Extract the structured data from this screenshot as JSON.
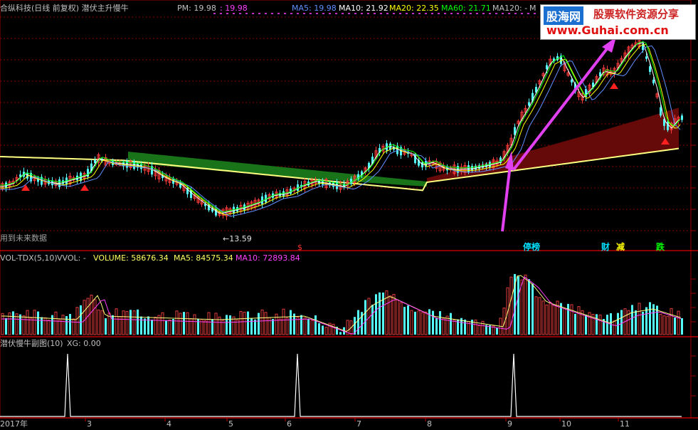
{
  "main_panel": {
    "title": "合纵科技(日线 前复权) 潜伏主升慢牛",
    "pm_label": "PM: 19.98",
    "pm_value": ": 19.98",
    "ma5": "MA5: 19.98",
    "ma10": "MA10: 21.92",
    "ma20": "MA20: 22.35",
    "ma60": "MA60: 21.71",
    "ma120": "MA120: -",
    "ma_extra": "M",
    "future_note": "用到未来数据",
    "low_price_label": "←13.59",
    "dollar_mark": "$",
    "tags": [
      {
        "text": "停榜",
        "color": "#00e0ff"
      },
      {
        "text": "财",
        "color": "#00e0ff"
      },
      {
        "text": "减",
        "color": "#ffff00"
      },
      {
        "text": "跌",
        "color": "#00ff00"
      }
    ]
  },
  "volume_panel": {
    "indicator": "VOL-TDX(5,10)",
    "vol": "VVOL: -",
    "volume": "VOLUME: 58676.34",
    "ma5": "MA5: 84575.34",
    "ma10": "MA10: 72893.84"
  },
  "sub_panel": {
    "indicator": "潜伏慢牛副图(10)",
    "xg": "XG: 0.00"
  },
  "time_axis": [
    "2017年",
    "3",
    "4",
    "5",
    "6",
    "7",
    "8",
    "9",
    "10",
    "11"
  ],
  "watermark": {
    "site_name": "股海网",
    "slogan": "股票软件资源分享",
    "url": "www.Guhai.com.cn"
  },
  "colors": {
    "up": "#ff3c3c",
    "down": "#54fcfc",
    "ma5": "#ffffff",
    "ma10": "#ffff00",
    "ma20": "#ff00ff",
    "ma60": "#00ff00",
    "band_green": "#1a7a1a",
    "band_red": "#6a0a0a",
    "arrow": "#e040f0"
  }
}
